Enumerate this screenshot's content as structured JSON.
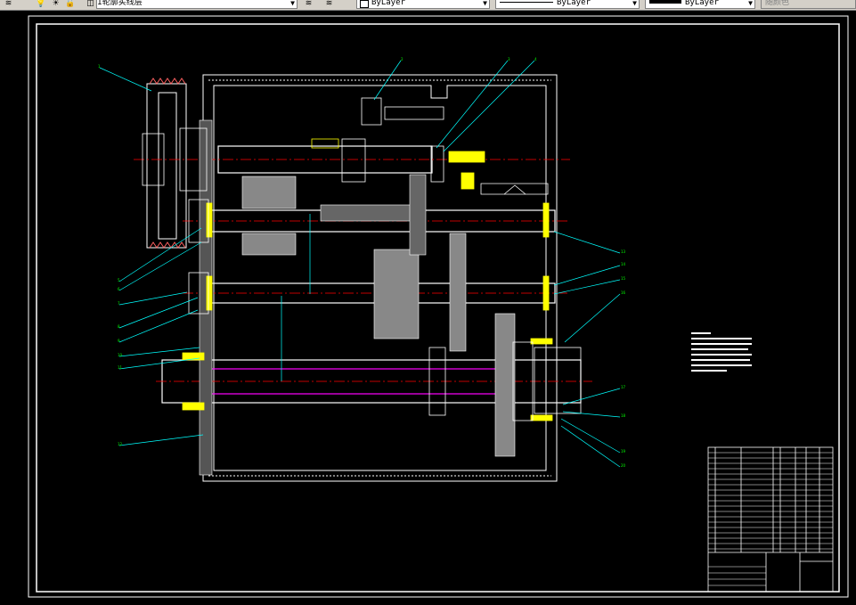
{
  "toolbar": {
    "layer_name": "1轮廓实线层",
    "color_value": "ByLayer",
    "linetype_value": "ByLayer",
    "lineweight_value": "ByLayer",
    "plotstyle_value": "随颜色",
    "icons": [
      "layer-manager-icon",
      "lightbulb-icon",
      "sun-icon",
      "lock-icon",
      "color-square-icon",
      "make-current-icon",
      "layer-previous-icon"
    ]
  },
  "colors": {
    "background": "#000000",
    "frame": "#ffffff",
    "outline": "#ffffff",
    "hatch": "#00ff00",
    "leader": "#00ffff",
    "center": "#ff0000",
    "hidden": "#ff00ff",
    "part": "#ffff00"
  },
  "drawing": {
    "type": "assembly-drawing",
    "balloon_marks": [
      "1",
      "2",
      "3",
      "4",
      "5",
      "6",
      "7",
      "8",
      "9",
      "10",
      "11",
      "12",
      "13",
      "14",
      "15",
      "16",
      "17",
      "18",
      "19",
      "20"
    ]
  }
}
